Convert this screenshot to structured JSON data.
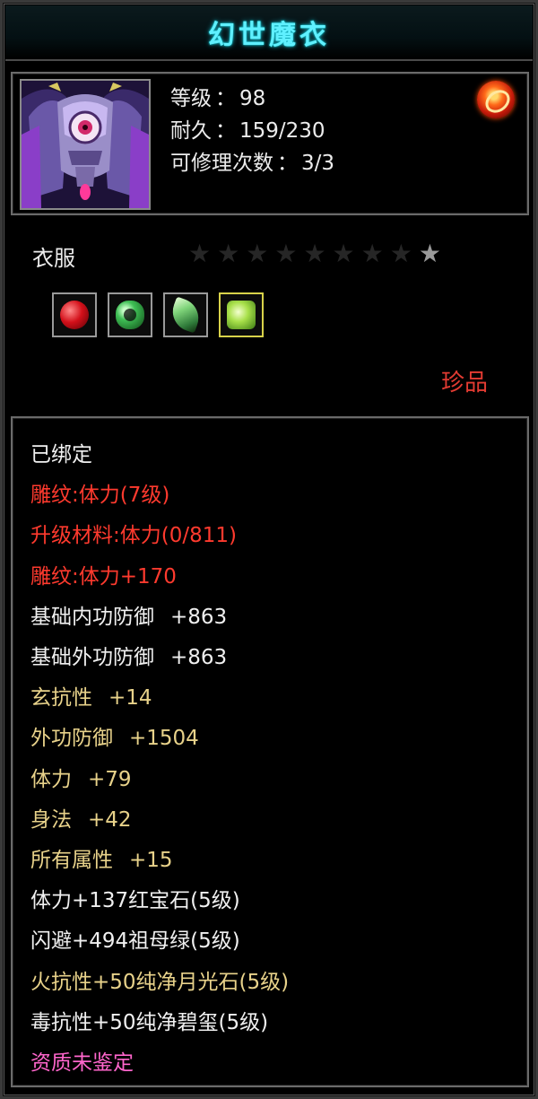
{
  "title": "幻世魔衣",
  "info": {
    "level_label": "等级",
    "level_value": "98",
    "durability_label": "耐久",
    "durability_value": "159/230",
    "repair_label": "可修理次数",
    "repair_value": "3/3",
    "separator": "："
  },
  "category": "衣服",
  "stars": {
    "total": 9,
    "filled": 1
  },
  "gems": [
    {
      "name": "ruby",
      "color": "#d3101a"
    },
    {
      "name": "jade-ring",
      "color": "#3fbf55"
    },
    {
      "name": "leaf-gem",
      "color": "#7fd47a"
    },
    {
      "name": "peridot",
      "color": "#a8e04a"
    }
  ],
  "rarity": "珍品",
  "attributes": [
    {
      "text": "已绑定",
      "value": "",
      "color": "white"
    },
    {
      "text": "雕纹:体力(7级)",
      "value": "",
      "color": "red"
    },
    {
      "text": "升级材料:体力(0/811)",
      "value": "",
      "color": "red"
    },
    {
      "text": "雕纹:体力+170",
      "value": "",
      "color": "red"
    },
    {
      "text": "基础内功防御",
      "value": "+863",
      "color": "white"
    },
    {
      "text": "基础外功防御",
      "value": "+863",
      "color": "white"
    },
    {
      "text": "玄抗性",
      "value": "+14",
      "color": "gold"
    },
    {
      "text": "外功防御",
      "value": "+1504",
      "color": "gold"
    },
    {
      "text": "体力",
      "value": "+79",
      "color": "gold"
    },
    {
      "text": "身法",
      "value": "+42",
      "color": "gold"
    },
    {
      "text": "所有属性",
      "value": "+15",
      "color": "gold"
    },
    {
      "text": "体力+137红宝石(5级)",
      "value": "",
      "color": "white"
    },
    {
      "text": "闪避+494祖母绿(5级)",
      "value": "",
      "color": "white"
    },
    {
      "text": "火抗性+50纯净月光石(5级)",
      "value": "",
      "color": "gold"
    },
    {
      "text": "毒抗性+50纯净碧玺(5级)",
      "value": "",
      "color": "white"
    },
    {
      "text": "资质未鉴定",
      "value": "",
      "color": "pink"
    }
  ],
  "colors": {
    "title": "#5ff0ff",
    "red": "#ff3a2e",
    "gold": "#e8d28a",
    "white": "#f0f0f0",
    "pink": "#ff66cc",
    "rarity": "#e23b32"
  }
}
